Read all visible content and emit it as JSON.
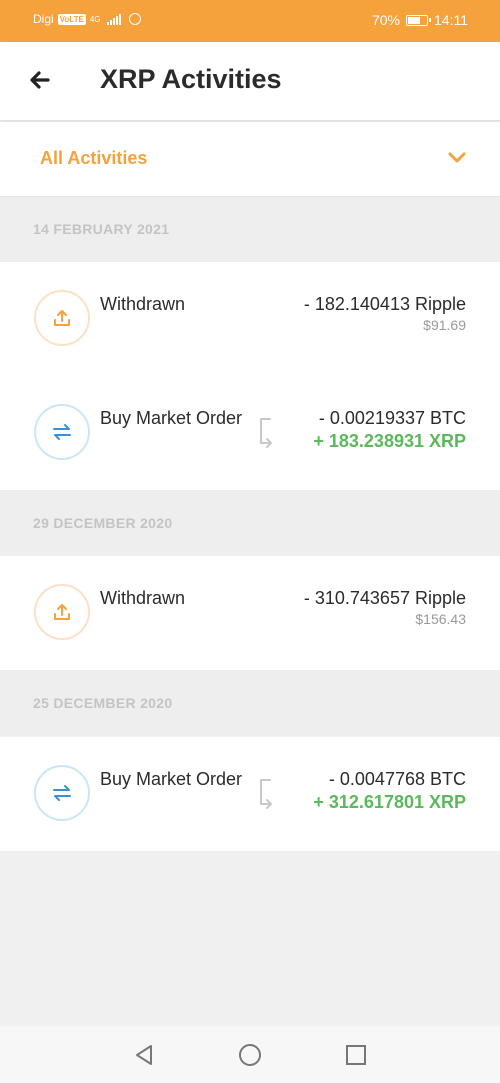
{
  "status_bar": {
    "carrier": "Digi",
    "volte": "VoLTE",
    "network": "4G",
    "battery": "70%",
    "battery_level": 0.7,
    "time": "14:11"
  },
  "header": {
    "title": "XRP Activities"
  },
  "filter": {
    "label": "All Activities"
  },
  "colors": {
    "accent": "#f5a13c",
    "positive": "#5cb85c",
    "trade_icon": "#3a8fd6"
  },
  "groups": [
    {
      "date": "14 FEBRUARY 2021",
      "items": [
        {
          "type": "withdraw",
          "icon": "upload-icon",
          "title": "Withdrawn",
          "amount": "- 182.140413 Ripple",
          "sub": "$91.69"
        },
        {
          "type": "trade",
          "icon": "swap-icon",
          "title": "Buy Market Order",
          "amount": "- 0.00219337 BTC",
          "received": "+ 183.238931 XRP"
        }
      ]
    },
    {
      "date": "29 DECEMBER 2020",
      "items": [
        {
          "type": "withdraw",
          "icon": "upload-icon",
          "title": "Withdrawn",
          "amount": "- 310.743657 Ripple",
          "sub": "$156.43"
        }
      ]
    },
    {
      "date": "25 DECEMBER 2020",
      "items": [
        {
          "type": "trade",
          "icon": "swap-icon",
          "title": "Buy Market Order",
          "amount": "- 0.0047768 BTC",
          "received": "+ 312.617801 XRP"
        }
      ]
    }
  ]
}
